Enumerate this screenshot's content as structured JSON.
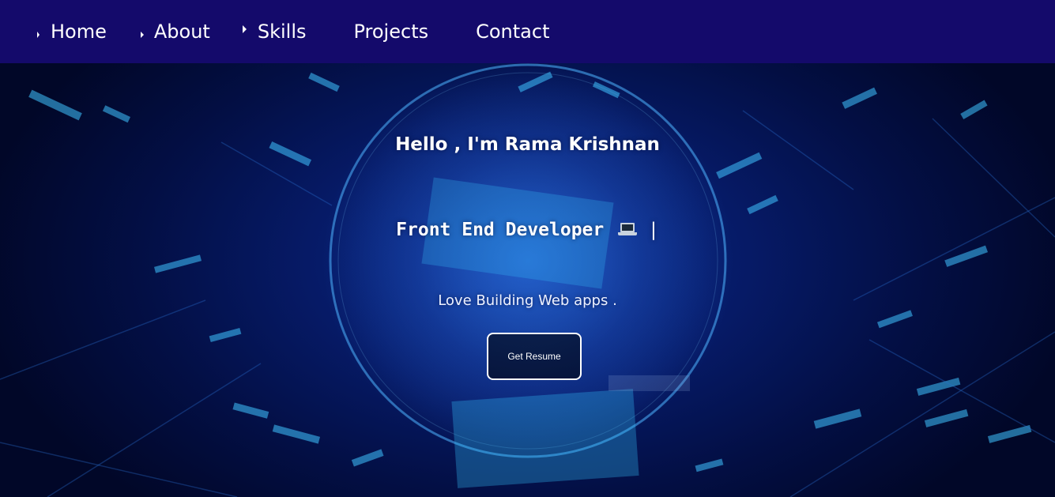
{
  "nav": {
    "items": [
      {
        "label": "Home"
      },
      {
        "label": "About"
      },
      {
        "label": "Skills"
      },
      {
        "label": "Projects"
      },
      {
        "label": "Contact"
      }
    ]
  },
  "hero": {
    "greeting": "Hello , I'm Rama Krishnan",
    "role": "Front End Developer",
    "role_icon": "laptop-icon",
    "cursor": "|",
    "tagline": "Love Building Web apps .",
    "resume_button": "Get Resume"
  },
  "colors": {
    "navbar": "#140a6b",
    "background": "#061a66",
    "text": "#ffffff"
  }
}
